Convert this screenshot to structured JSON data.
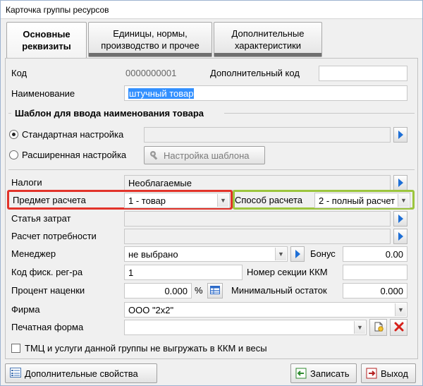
{
  "window": {
    "title": "Карточка группы ресурсов"
  },
  "tabs": [
    {
      "label": "Основные\nреквизиты"
    },
    {
      "label": "Единицы, нормы,\nпроизводство и прочее"
    },
    {
      "label": "Дополнительные\nхарактеристики"
    }
  ],
  "form": {
    "code_label": "Код",
    "code_value": "0000000001",
    "extra_code_label": "Дополнительный код",
    "extra_code_value": "",
    "name_label": "Наименование",
    "name_value": "штучный товар",
    "template_section": "Шаблон для ввода наименования товара",
    "standard_label": "Стандартная настройка",
    "standard_value": "",
    "extended_label": "Расширенная настройка",
    "template_button": "Настройка шаблона",
    "taxes_label": "Налоги",
    "taxes_value": "Необлагаемые",
    "subject_label": "Предмет расчета",
    "subject_value": "1 - товар",
    "method_label": "Способ расчета",
    "method_value": "2 - полный расчет",
    "cost_label": "Статья затрат",
    "cost_value": "",
    "need_label": "Расчет потребности",
    "need_value": "",
    "manager_label": "Менеджер",
    "manager_value": "не выбрано",
    "bonus_label": "Бонус",
    "bonus_value": "0.00",
    "fiscal_label": "Код фиск. рег-ра",
    "fiscal_value": "1",
    "kkm_label": "Номер секции ККМ",
    "kkm_value": "",
    "markup_label": "Процент наценки",
    "markup_value": "0.000",
    "markup_unit": "%",
    "minstock_label": "Минимальный остаток",
    "minstock_value": "0.000",
    "firm_label": "Фирма",
    "firm_value": "ООО \"2х2\"",
    "print_label": "Печатная форма",
    "print_value": "",
    "checkbox_label": "ТМЦ и услуги данной группы не выгружать в ККМ и весы"
  },
  "footer": {
    "extra_props": "Дополнительные свойства",
    "save": "Записать",
    "exit": "Выход"
  },
  "colors": {
    "highlight_red": "#e2332a",
    "highlight_green": "#9cc53e",
    "selection": "#3390ff",
    "accent_arrow": "#1e6fd6"
  }
}
